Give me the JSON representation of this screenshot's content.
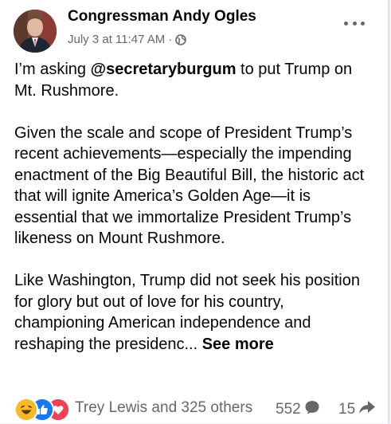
{
  "post": {
    "author": "Congressman Andy Ogles",
    "timestamp": "July 3 at 11:47 AM",
    "separator": "·",
    "privacy_icon": "globe-icon",
    "menu_icon": "more-options-icon",
    "paragraph_1": {
      "prefix": "I’m asking ",
      "mention": "@secretaryburgum",
      "suffix": " to put Trump on Mt. Rushmore."
    },
    "paragraph_2": "Given the scale and scope of President Trump’s recent achievements—especially the impending enactment of the Big Beautiful Bill, the historic act that will ignite America’s Golden Age—it is essential that we immortalize President Trump’s likeness on Mount Rushmore.",
    "paragraph_3": {
      "text": "Like Washington, Trump did not seek his position for glory but out of love for his country, championing American independence and reshaping the presidenc... ",
      "see_more": "See more"
    }
  },
  "engagement": {
    "reaction_icons": [
      "haha-reaction-icon",
      "like-reaction-icon",
      "love-reaction-icon"
    ],
    "reactions_text": "Trey Lewis and 325 others",
    "comments_count": "552",
    "comment_icon": "comment-bubble-icon",
    "shares_count": "15",
    "share_icon": "share-arrow-icon"
  },
  "colors": {
    "text_primary": "#050505",
    "text_secondary": "#65676b",
    "like_blue": "#1877f2",
    "love_red": "#f33e58",
    "haha_yellow": "#f7b928"
  }
}
